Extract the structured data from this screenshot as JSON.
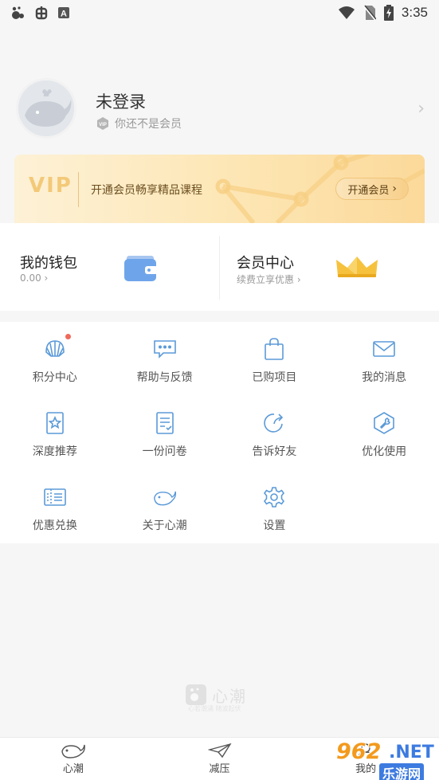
{
  "status_bar": {
    "time": "3:35",
    "left_icons": [
      "app-notification-icon",
      "bug-icon",
      "text-a-icon"
    ],
    "right_icons": [
      "wifi-icon",
      "no-sim-icon",
      "battery-charging-icon"
    ]
  },
  "profile": {
    "name": "未登录",
    "member_status": "你还不是会员"
  },
  "vip_banner": {
    "logo": "VIP",
    "text": "开通会员畅享精品课程",
    "button_label": "开通会员"
  },
  "wallet": {
    "title": "我的钱包",
    "value": "0.00"
  },
  "member_center": {
    "title": "会员中心",
    "subtitle": "续费立享优惠"
  },
  "grid": {
    "items": [
      {
        "label": "积分中心",
        "icon": "shell-icon",
        "has_dot": true
      },
      {
        "label": "帮助与反馈",
        "icon": "chat-bubble-icon"
      },
      {
        "label": "已购项目",
        "icon": "shopping-bag-icon"
      },
      {
        "label": "我的消息",
        "icon": "envelope-icon"
      },
      {
        "label": "深度推荐",
        "icon": "bookmark-star-icon"
      },
      {
        "label": "一份问卷",
        "icon": "questionnaire-icon"
      },
      {
        "label": "告诉好友",
        "icon": "share-icon"
      },
      {
        "label": "优化使用",
        "icon": "wrench-icon"
      },
      {
        "label": "优惠兑换",
        "icon": "coupon-icon"
      },
      {
        "label": "关于心潮",
        "icon": "whale-icon"
      },
      {
        "label": "设置",
        "icon": "gear-icon"
      }
    ]
  },
  "watermark": {
    "title": "心潮",
    "subtitle": "心若潮涌 随波起伏"
  },
  "tabbar": {
    "tabs": [
      {
        "label": "心潮",
        "icon": "whale-tab-icon"
      },
      {
        "label": "减压",
        "icon": "paper-plane-icon"
      },
      {
        "label": "我的",
        "icon": "person-tab-icon"
      }
    ]
  },
  "overlay_badge": {
    "number": "962",
    "net": ".NET",
    "sub": "乐游网"
  },
  "colors": {
    "accent_blue": "#5b9ad8",
    "vip_gold": "#f3c978",
    "badge_red": "#f06a5a"
  }
}
